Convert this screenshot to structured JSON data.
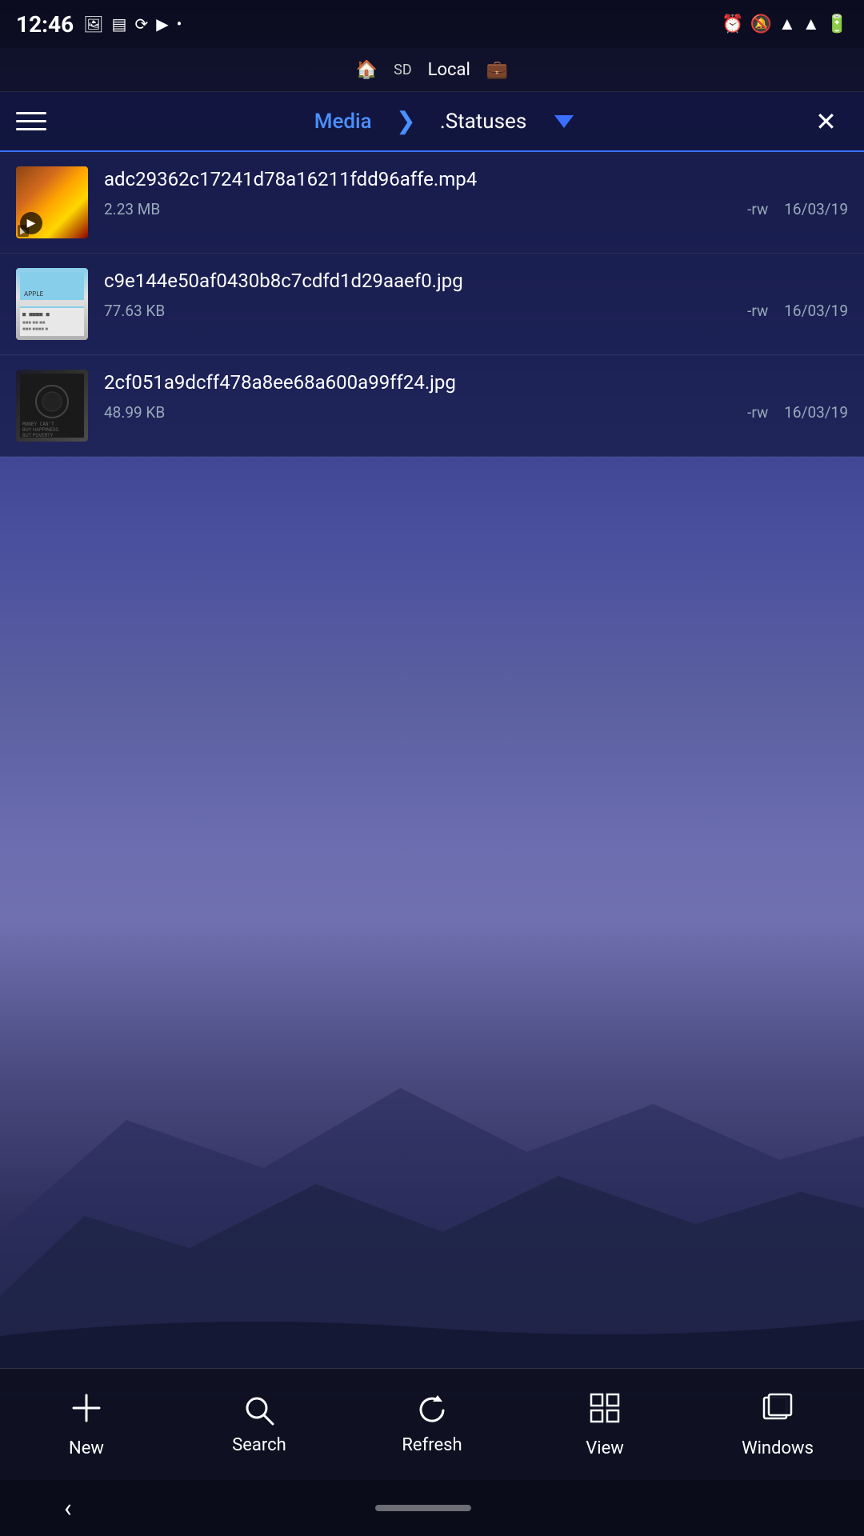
{
  "statusBar": {
    "time": "12:46",
    "icons": [
      "photo-icon",
      "message-icon",
      "sync-icon",
      "youtube-icon",
      "dot-icon"
    ]
  },
  "locationBar": {
    "homeIcon": "🏠",
    "sdIcon": "💾",
    "label": "Local",
    "storageIcon": "💼"
  },
  "header": {
    "tabs": [
      {
        "label": "Media",
        "active": true
      },
      {
        "label": ".Statuses",
        "active": false
      }
    ],
    "separator": "❯"
  },
  "files": [
    {
      "id": 1,
      "name": "adc29362c17241d78a16211fdd96affe.mp4",
      "size": "2.23 MB",
      "permissions": "-rw",
      "date": "16/03/19",
      "type": "video",
      "thumbType": "video"
    },
    {
      "id": 2,
      "name": "c9e144e50af0430b8c7cdfd1d29aaef0.jpg",
      "size": "77.63 KB",
      "permissions": "-rw",
      "date": "16/03/19",
      "type": "image",
      "thumbType": "img1"
    },
    {
      "id": 3,
      "name": "2cf051a9dcff478a8ee68a600a99ff24.jpg",
      "size": "48.99 KB",
      "permissions": "-rw",
      "date": "16/03/19",
      "type": "image",
      "thumbType": "img2"
    }
  ],
  "toolbar": {
    "buttons": [
      {
        "id": "new",
        "label": "New",
        "icon": "plus"
      },
      {
        "id": "search",
        "label": "Search",
        "icon": "search"
      },
      {
        "id": "refresh",
        "label": "Refresh",
        "icon": "refresh"
      },
      {
        "id": "view",
        "label": "View",
        "icon": "grid"
      },
      {
        "id": "windows",
        "label": "Windows",
        "icon": "windows"
      }
    ]
  }
}
